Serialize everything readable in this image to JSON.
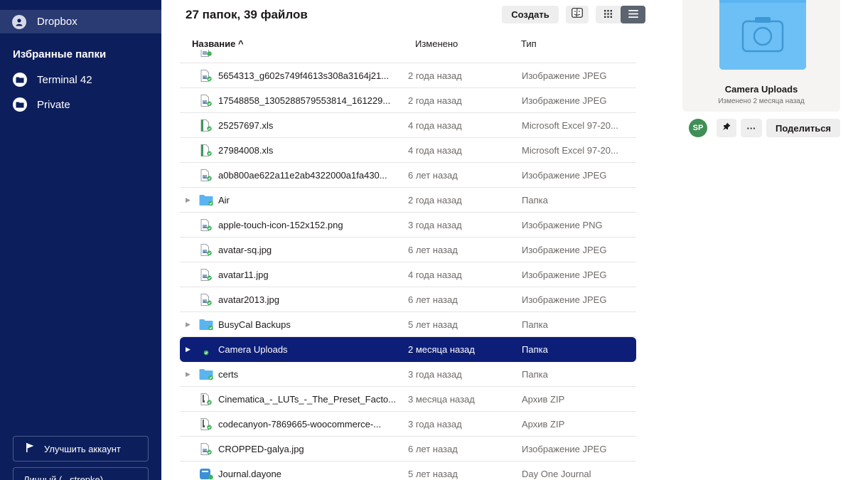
{
  "sidebar": {
    "account_label": "Dropbox",
    "favorites_heading": "Избранные папки",
    "favorites": [
      {
        "label": "Terminal 42"
      },
      {
        "label": "Private"
      }
    ],
    "upgrade_label": "Улучшить аккаунт",
    "plan_label": "Личный (...strepke)"
  },
  "header": {
    "title": "27 папок, 39 файлов",
    "create_label": "Создать"
  },
  "columns": {
    "name": "Название ^",
    "modified": "Изменено",
    "type": "Тип"
  },
  "rows": [
    {
      "name": "5654313_g602s749f4613s308a3164j21...",
      "modified": "2 года назад",
      "type": "Изображение JPEG",
      "icon": "image-file-icon",
      "expandable": false,
      "selected": false
    },
    {
      "name": "17548858_1305288579553814_161229...",
      "modified": "2 года назад",
      "type": "Изображение JPEG",
      "icon": "image-file-icon",
      "expandable": false,
      "selected": false
    },
    {
      "name": "25257697.xls",
      "modified": "4 года назад",
      "type": "Microsoft Excel 97-20...",
      "icon": "excel-file-icon",
      "expandable": false,
      "selected": false
    },
    {
      "name": "27984008.xls",
      "modified": "4 года назад",
      "type": "Microsoft Excel 97-20...",
      "icon": "excel-file-icon",
      "expandable": false,
      "selected": false
    },
    {
      "name": "a0b800ae622a11e2ab4322000a1fa430...",
      "modified": "6 лет назад",
      "type": "Изображение JPEG",
      "icon": "image-file-icon",
      "expandable": false,
      "selected": false
    },
    {
      "name": "Air",
      "modified": "2 года назад",
      "type": "Папка",
      "icon": "folder-icon",
      "expandable": true,
      "selected": false
    },
    {
      "name": "apple-touch-icon-152x152.png",
      "modified": "3 года назад",
      "type": "Изображение PNG",
      "icon": "image-file-icon",
      "expandable": false,
      "selected": false
    },
    {
      "name": "avatar-sq.jpg",
      "modified": "6 лет назад",
      "type": "Изображение JPEG",
      "icon": "image-file-icon",
      "expandable": false,
      "selected": false
    },
    {
      "name": "avatar11.jpg",
      "modified": "4 года назад",
      "type": "Изображение JPEG",
      "icon": "image-file-icon",
      "expandable": false,
      "selected": false
    },
    {
      "name": "avatar2013.jpg",
      "modified": "6 лет назад",
      "type": "Изображение JPEG",
      "icon": "image-file-icon",
      "expandable": false,
      "selected": false
    },
    {
      "name": "BusyCal Backups",
      "modified": "5 лет назад",
      "type": "Папка",
      "icon": "folder-icon",
      "expandable": true,
      "selected": false
    },
    {
      "name": "Camera Uploads",
      "modified": "2 месяца назад",
      "type": "Папка",
      "icon": "camera-folder-icon",
      "expandable": true,
      "selected": true
    },
    {
      "name": "certs",
      "modified": "3 года назад",
      "type": "Папка",
      "icon": "folder-icon",
      "expandable": true,
      "selected": false
    },
    {
      "name": "Cinematica_-_LUTs_-_The_Preset_Facto...",
      "modified": "3 месяца назад",
      "type": "Архив ZIP",
      "icon": "zip-file-icon",
      "expandable": false,
      "selected": false
    },
    {
      "name": "codecanyon-7869665-woocommerce-...",
      "modified": "3 года назад",
      "type": "Архив ZIP",
      "icon": "zip-file-icon",
      "expandable": false,
      "selected": false
    },
    {
      "name": "CROPPED-galya.jpg",
      "modified": "6 лет назад",
      "type": "Изображение JPEG",
      "icon": "image-file-icon",
      "expandable": false,
      "selected": false
    },
    {
      "name": "Journal.dayone",
      "modified": "5 лет назад",
      "type": "Day One Journal",
      "icon": "dayone-file-icon",
      "expandable": false,
      "selected": false
    }
  ],
  "preview": {
    "name": "Camera Uploads",
    "subtitle": "Изменено 2 месяца назад",
    "owner_initials": "SP",
    "share_label": "Поделиться"
  },
  "colors": {
    "sidebar_bg": "#0d1e5c",
    "selected_row": "#0d1e78",
    "folder_blue": "#5ab4f0",
    "sync_green": "#3fb45a"
  }
}
